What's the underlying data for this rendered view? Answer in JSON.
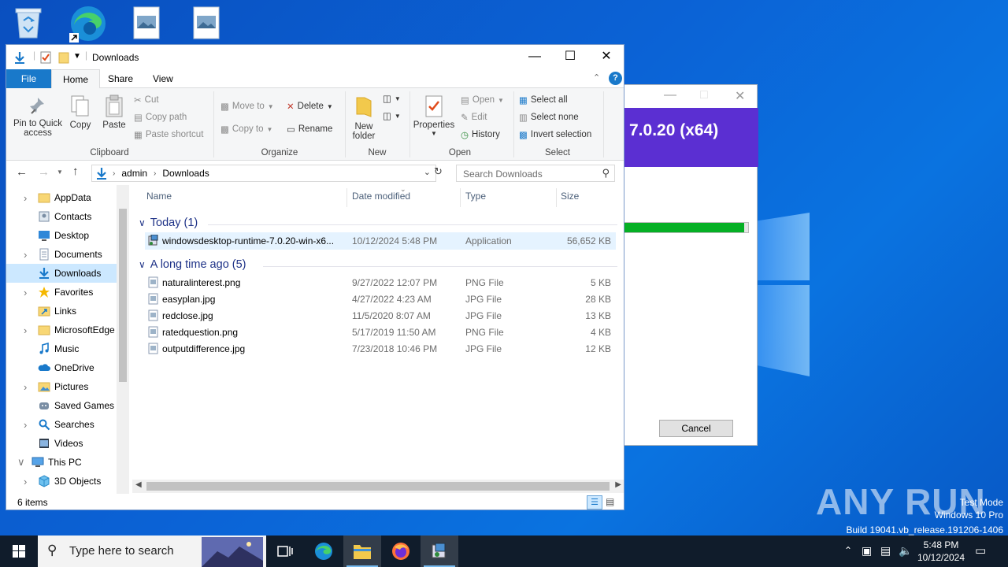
{
  "explorer": {
    "title": "Downloads",
    "tabs": [
      "File",
      "Home",
      "Share",
      "View"
    ],
    "ribbon": {
      "clipboard": {
        "label": "Clipboard",
        "pin": "Pin to Quick access",
        "pin_l1": "Pin to Quick",
        "pin_l2": "access",
        "copy": "Copy",
        "paste": "Paste",
        "cut": "Cut",
        "copy_path": "Copy path",
        "paste_shortcut": "Paste shortcut"
      },
      "organize": {
        "label": "Organize",
        "move_to": "Move to",
        "copy_to": "Copy to",
        "delete": "Delete",
        "rename": "Rename"
      },
      "new": {
        "label": "New",
        "new_folder_l1": "New",
        "new_folder_l2": "folder"
      },
      "open": {
        "label": "Open",
        "properties": "Properties",
        "open": "Open",
        "edit": "Edit",
        "history": "History"
      },
      "select": {
        "label": "Select",
        "select_all": "Select all",
        "select_none": "Select none",
        "invert": "Invert selection"
      }
    },
    "address": {
      "crumbs": [
        "admin",
        "Downloads"
      ]
    },
    "search": {
      "placeholder": "Search Downloads"
    },
    "nav": [
      {
        "label": "AppData",
        "icon": "folder-icon",
        "chev": true
      },
      {
        "label": "Contacts",
        "icon": "contacts-icon",
        "chev": false
      },
      {
        "label": "Desktop",
        "icon": "desktop-icon",
        "chev": false
      },
      {
        "label": "Documents",
        "icon": "documents-icon",
        "chev": true
      },
      {
        "label": "Downloads",
        "icon": "download-icon",
        "chev": false,
        "selected": true
      },
      {
        "label": "Favorites",
        "icon": "star-icon",
        "chev": true
      },
      {
        "label": "Links",
        "icon": "links-icon",
        "chev": false
      },
      {
        "label": "MicrosoftEdge",
        "icon": "folder-icon",
        "chev": true
      },
      {
        "label": "Music",
        "icon": "music-icon",
        "chev": false
      },
      {
        "label": "OneDrive",
        "icon": "cloud-icon",
        "chev": false
      },
      {
        "label": "Pictures",
        "icon": "pictures-icon",
        "chev": true
      },
      {
        "label": "Saved Games",
        "icon": "games-icon",
        "chev": false
      },
      {
        "label": "Searches",
        "icon": "search-icon",
        "chev": true
      },
      {
        "label": "Videos",
        "icon": "videos-icon",
        "chev": false
      },
      {
        "label": "This PC",
        "icon": "pc-icon",
        "chev": "open"
      },
      {
        "label": "3D Objects",
        "icon": "cube-icon",
        "chev": true
      }
    ],
    "columns": [
      "Name",
      "Date modified",
      "Type",
      "Size"
    ],
    "groups": [
      {
        "title": "Today (1)",
        "files": [
          {
            "name": "windowsdesktop-runtime-7.0.20-win-x6...",
            "date": "10/12/2024 5:48 PM",
            "type": "Application",
            "size": "56,652 KB",
            "selected": true
          }
        ]
      },
      {
        "title": "A long time ago (5)",
        "files": [
          {
            "name": "naturalinterest.png",
            "date": "9/27/2022 12:07 PM",
            "type": "PNG File",
            "size": "5 KB"
          },
          {
            "name": "easyplan.jpg",
            "date": "4/27/2022 4:23 AM",
            "type": "JPG File",
            "size": "28 KB"
          },
          {
            "name": "redclose.jpg",
            "date": "11/5/2020 8:07 AM",
            "type": "JPG File",
            "size": "13 KB"
          },
          {
            "name": "ratedquestion.png",
            "date": "5/17/2019 11:50 AM",
            "type": "PNG File",
            "size": "4 KB"
          },
          {
            "name": "outputdifference.jpg",
            "date": "7/23/2018 10:46 PM",
            "type": "JPG File",
            "size": "12 KB"
          }
        ]
      }
    ],
    "status": "6 items"
  },
  "installer": {
    "banner": "7.0.20 (x64)",
    "cancel": "Cancel",
    "progress": 0.97
  },
  "watermark": {
    "text": "ANY RUN",
    "test_mode": "Test Mode",
    "edition": "Windows 10 Pro",
    "build": "Build 19041.vb_release.191206-1406"
  },
  "taskbar": {
    "search_placeholder": "Type here to search",
    "time": "5:48 PM",
    "date": "10/12/2024"
  },
  "colors": {
    "accent": "#1979ca",
    "installer_banner": "#5b2fd2",
    "progress": "#06b025",
    "taskbar": "#101c2b"
  }
}
